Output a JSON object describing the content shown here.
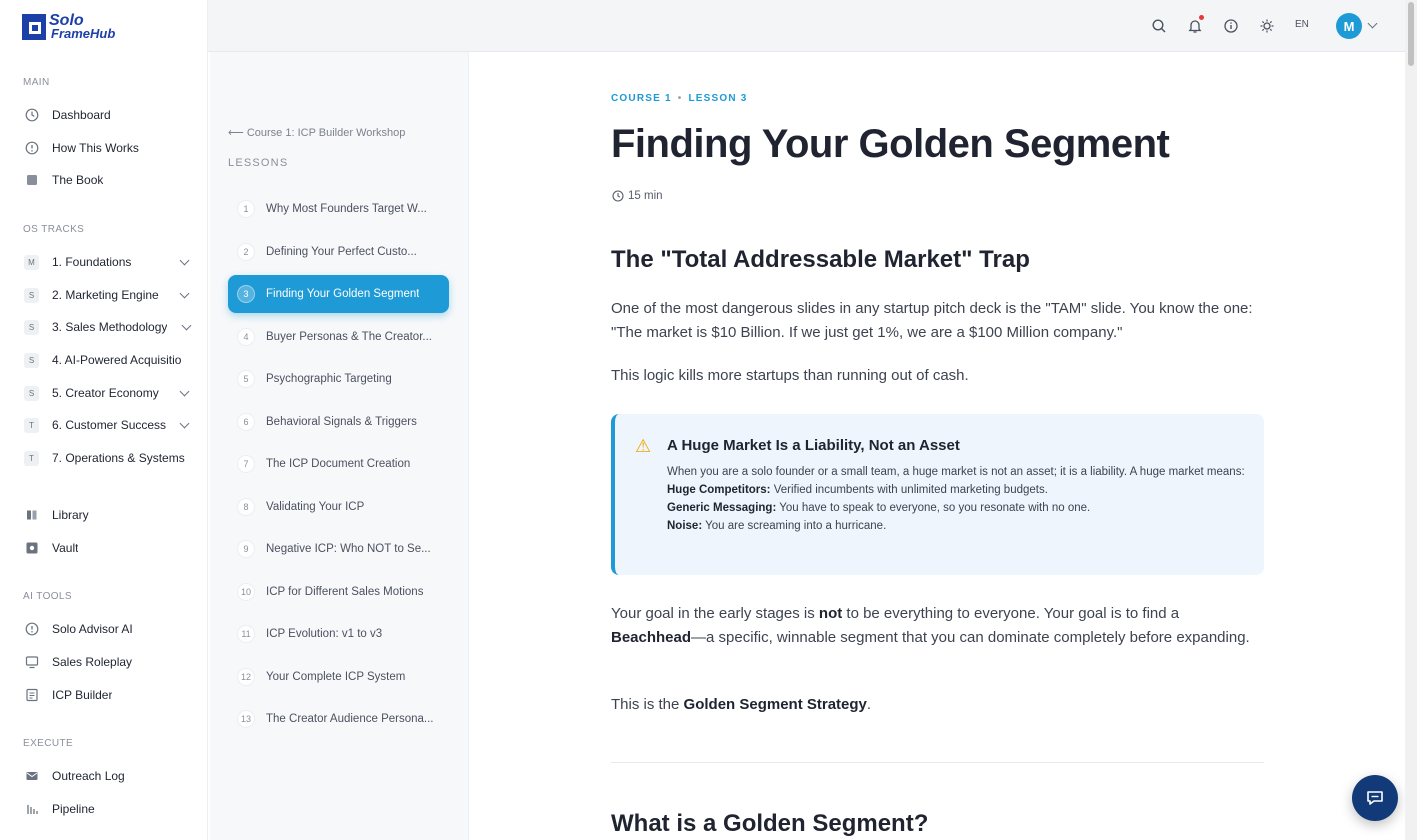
{
  "brand": {
    "line1": "Solo",
    "line2": "FrameHub"
  },
  "sidebar": {
    "main_heading": "MAIN",
    "main_items": [
      {
        "label": "Dashboard",
        "icon": "dashboard-icon"
      },
      {
        "label": "How This Works",
        "icon": "info-icon"
      },
      {
        "label": "The Book",
        "icon": "book-icon"
      }
    ],
    "tracks_heading": "OS TRACKS",
    "tracks": [
      {
        "badge": "M",
        "label": "1. Foundations",
        "expandable": true
      },
      {
        "badge": "S",
        "label": "2. Marketing Engine",
        "expandable": true
      },
      {
        "badge": "S",
        "label": "3. Sales Methodology",
        "expandable": true
      },
      {
        "badge": "S",
        "label": "4. AI-Powered Acquisitio",
        "expandable": false
      },
      {
        "badge": "S",
        "label": "5. Creator Economy",
        "expandable": true
      },
      {
        "badge": "T",
        "label": "6. Customer Success",
        "expandable": true
      },
      {
        "badge": "T",
        "label": "7. Operations & Systems",
        "expandable": false
      }
    ],
    "extra_items": [
      {
        "label": "Library",
        "icon": "library-icon"
      },
      {
        "label": "Vault",
        "icon": "vault-icon"
      }
    ],
    "ai_heading": "AI TOOLS",
    "ai_items": [
      {
        "label": "Solo Advisor AI",
        "icon": "advisor-icon"
      },
      {
        "label": "Sales Roleplay",
        "icon": "monitor-icon"
      },
      {
        "label": "ICP Builder",
        "icon": "document-icon"
      }
    ],
    "execute_heading": "EXECUTE",
    "execute_items": [
      {
        "label": "Outreach Log",
        "icon": "mail-icon"
      },
      {
        "label": "Pipeline",
        "icon": "pipeline-icon"
      }
    ]
  },
  "topbar": {
    "language": "EN",
    "avatar_initial": "M"
  },
  "lessons_panel": {
    "back_label": "Course 1: ICP Builder Workshop",
    "heading": "LESSONS",
    "active_index": 2,
    "items": [
      {
        "num": "1",
        "title": "Why Most Founders Target W..."
      },
      {
        "num": "2",
        "title": "Defining Your Perfect Custo..."
      },
      {
        "num": "3",
        "title": "Finding Your Golden Segment"
      },
      {
        "num": "4",
        "title": "Buyer Personas & The Creator..."
      },
      {
        "num": "5",
        "title": "Psychographic Targeting"
      },
      {
        "num": "6",
        "title": "Behavioral Signals & Triggers"
      },
      {
        "num": "7",
        "title": "The ICP Document Creation"
      },
      {
        "num": "8",
        "title": "Validating Your ICP"
      },
      {
        "num": "9",
        "title": "Negative ICP: Who NOT to Se..."
      },
      {
        "num": "10",
        "title": "ICP for Different Sales Motions"
      },
      {
        "num": "11",
        "title": "ICP Evolution: v1 to v3"
      },
      {
        "num": "12",
        "title": "Your Complete ICP System"
      },
      {
        "num": "13",
        "title": "The Creator Audience Persona..."
      }
    ]
  },
  "article": {
    "course_crumb": "COURSE 1",
    "lesson_crumb": "LESSON 3",
    "title": "Finding Your Golden Segment",
    "duration": "15 min",
    "section1_heading": "The \"Total Addressable Market\" Trap",
    "p1": "One of the most dangerous slides in any startup pitch deck is the \"TAM\" slide. You know the one: \"The market is $10 Billion. If we just get 1%, we are a $100 Million company.\"",
    "p2": "This logic kills more startups than running out of cash.",
    "callout": {
      "icon": "warning-icon",
      "title": "A Huge Market Is a Liability, Not an Asset",
      "intro": "When you are a solo founder or a small team, a huge market is not an asset; it is a liability. A huge market means:",
      "items": [
        {
          "label": "Huge Competitors:",
          "text": " Verified incumbents with unlimited marketing budgets."
        },
        {
          "label": "Generic Messaging:",
          "text": " You have to speak to everyone, so you resonate with no one."
        },
        {
          "label": "Noise:",
          "text": " You are screaming into a hurricane."
        }
      ]
    },
    "p3_a": "Your goal in the early stages is ",
    "p3_b": "not",
    "p3_c": " to be everything to everyone. Your goal is to find a ",
    "p3_d": "Beachhead",
    "p3_e": "—a specific, winnable segment that you can dominate completely before expanding.",
    "p4_a": "This is the ",
    "p4_b": "Golden Segment Strategy",
    "p4_c": ".",
    "section2_heading": "What is a Golden Segment?"
  },
  "colors": {
    "accent": "#1e9ad6",
    "brand": "#1c3fa8",
    "fab": "#123a78"
  }
}
